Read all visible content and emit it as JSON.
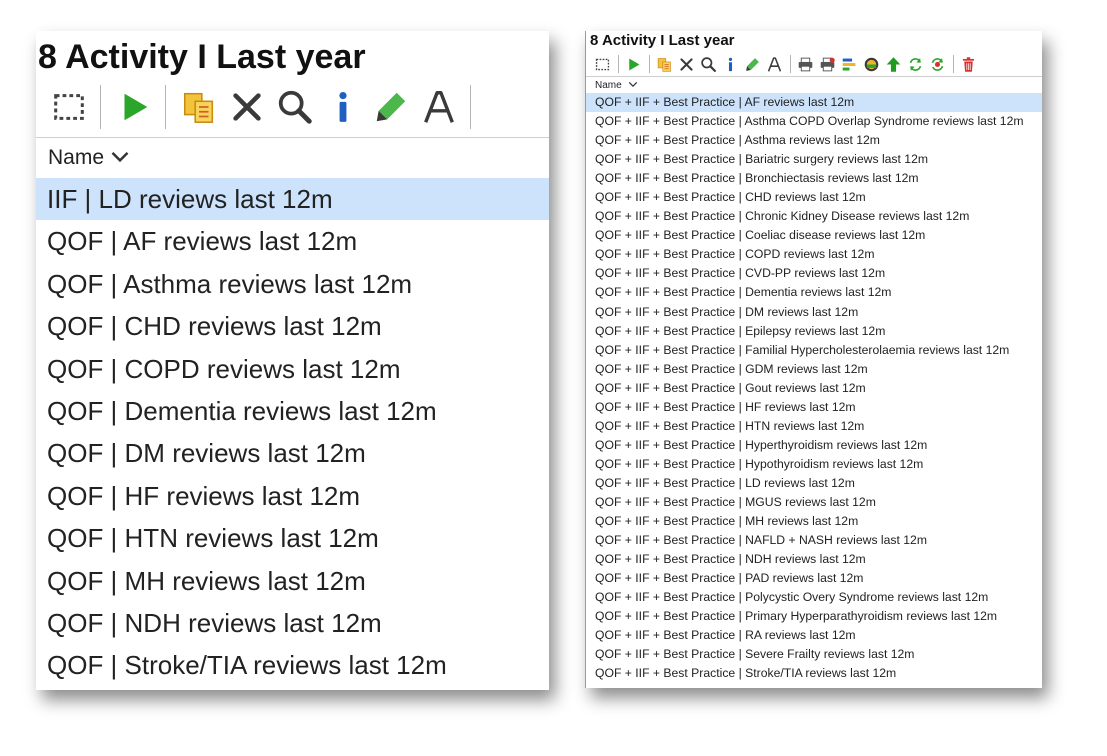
{
  "left_panel": {
    "title": "8 Activity I Last year",
    "column_header": "Name",
    "selected_index": 0,
    "items": [
      "IIF | LD reviews last 12m",
      "QOF | AF reviews last 12m",
      "QOF | Asthma reviews last 12m",
      "QOF | CHD reviews last 12m",
      "QOF | COPD reviews last 12m",
      "QOF | Dementia reviews last 12m",
      "QOF | DM reviews last 12m",
      "QOF | HF reviews last 12m",
      "QOF | HTN reviews last 12m",
      "QOF | MH reviews last 12m",
      "QOF | NDH reviews last 12m",
      "QOF | Stroke/TIA reviews last 12m"
    ]
  },
  "right_panel": {
    "title": "8 Activity I Last year",
    "column_header": "Name",
    "selected_index": 0,
    "items": [
      "QOF + IIF + Best Practice | AF reviews last 12m",
      "QOF + IIF + Best Practice | Asthma COPD Overlap Syndrome reviews last 12m",
      "QOF + IIF + Best Practice | Asthma reviews last 12m",
      "QOF + IIF + Best Practice | Bariatric surgery reviews last 12m",
      "QOF + IIF + Best Practice | Bronchiectasis reviews last 12m",
      "QOF + IIF + Best Practice | CHD reviews last 12m",
      "QOF + IIF + Best Practice | Chronic Kidney Disease reviews last 12m",
      "QOF + IIF + Best Practice | Coeliac disease reviews last 12m",
      "QOF + IIF + Best Practice | COPD reviews last 12m",
      "QOF + IIF + Best Practice | CVD-PP reviews last 12m",
      "QOF + IIF + Best Practice | Dementia reviews last 12m",
      "QOF + IIF + Best Practice | DM reviews last 12m",
      "QOF + IIF + Best Practice | Epilepsy reviews last 12m",
      "QOF + IIF + Best Practice | Familial Hypercholesterolaemia reviews last 12m",
      "QOF + IIF + Best Practice | GDM reviews last 12m",
      "QOF + IIF + Best Practice | Gout reviews last 12m",
      "QOF + IIF + Best Practice | HF reviews last 12m",
      "QOF + IIF + Best Practice | HTN reviews last 12m",
      "QOF + IIF + Best Practice | Hyperthyroidism reviews last 12m",
      "QOF + IIF + Best Practice | Hypothyroidism reviews last 12m",
      "QOF + IIF + Best Practice | LD reviews last 12m",
      "QOF + IIF + Best Practice | MGUS reviews last 12m",
      "QOF + IIF + Best Practice | MH reviews last 12m",
      "QOF + IIF + Best Practice | NAFLD + NASH reviews last 12m",
      "QOF + IIF + Best Practice | NDH reviews last 12m",
      "QOF + IIF + Best Practice | PAD reviews last 12m",
      "QOF + IIF + Best Practice | Polycystic Overy Syndrome reviews last 12m",
      "QOF + IIF + Best Practice | Primary Hyperparathyroidism reviews last 12m",
      "QOF + IIF + Best Practice | RA reviews last 12m",
      "QOF + IIF + Best Practice | Severe Frailty reviews last 12m",
      "QOF + IIF + Best Practice | Stroke/TIA reviews last 12m"
    ]
  },
  "toolbar_icons": {
    "left": [
      "select-icon",
      "run-icon",
      "copy-icon",
      "delete-icon",
      "search-icon",
      "info-icon",
      "edit-icon",
      "rename-icon"
    ],
    "right": [
      "select-icon",
      "run-icon",
      "copy-icon",
      "delete-icon",
      "search-icon",
      "info-icon",
      "edit-icon",
      "rename-icon",
      "print-icon",
      "print-red-icon",
      "export-icon",
      "schedule-icon",
      "move-up-icon",
      "refresh-icon",
      "refresh-red-icon",
      "trash-icon"
    ]
  },
  "colors": {
    "selected_row": "#cce3fb",
    "run_green": "#2aa62a",
    "info_blue": "#1f5fbf",
    "trash_red": "#d9302c"
  }
}
